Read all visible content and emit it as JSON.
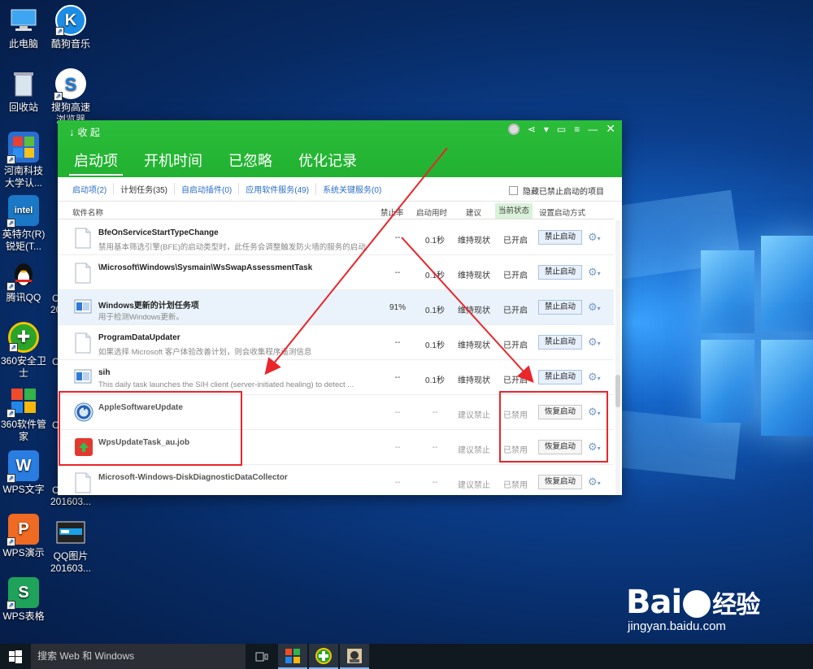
{
  "desktop": {
    "icons": [
      {
        "label": "此电脑",
        "glyph": "pc-icon"
      },
      {
        "label": "回收站",
        "glyph": "recycle-bin-icon"
      },
      {
        "label": "河南科技大学认...",
        "glyph": "shield-app-icon"
      },
      {
        "label": "英特尔(R) 锐矩(T...",
        "glyph": "intel-icon"
      },
      {
        "label": "腾讯QQ",
        "glyph": "qq-penguin-icon"
      },
      {
        "label": "360安全卫士",
        "glyph": "360-plus-icon"
      },
      {
        "label": "360软件管家",
        "glyph": "360-apps-icon"
      },
      {
        "label": "WPS文字",
        "glyph": "wps-writer-icon"
      },
      {
        "label": "WPS演示",
        "glyph": "wps-presentation-icon"
      },
      {
        "label": "WPS表格",
        "glyph": "wps-spreadsheet-icon"
      },
      {
        "label": "酷狗音乐",
        "glyph": "kugou-icon"
      },
      {
        "label": "搜狗高速浏览器",
        "glyph": "sogou-browser-icon"
      },
      {
        "label": "QQ图片 201603...",
        "glyph": "qq-image-icon"
      }
    ],
    "partial_labels": [
      "C",
      "201",
      "C",
      "C",
      "C",
      "C",
      "201603..."
    ]
  },
  "app": {
    "collapse_label": "收 起",
    "tabs": [
      "启动项",
      "开机时间",
      "已忽略",
      "优化记录"
    ],
    "active_tab": 0,
    "subtabs": [
      "启动项(2)",
      "计划任务(35)",
      "自启动插件(0)",
      "应用软件服务(49)",
      "系统关键服务(0)"
    ],
    "active_subtab": 1,
    "hide_disabled_label": "隐藏已禁止启动的项目",
    "columns": {
      "name": "软件名称",
      "disable_rate": "禁止率",
      "boot_time": "启动用时",
      "advice": "建议",
      "current_state": "当前状态",
      "set_mode": "设置启动方式"
    },
    "rows": [
      {
        "name": "BfeOnServiceStartTypeChange",
        "desc": "禁用基本筛选引擎(BFE)的启动类型时，此任务会调整触发防火墙的服务的启动类...",
        "rate": "--",
        "time": "0.1秒",
        "advice": "维持现状",
        "state": "已开启",
        "action": "禁止启动",
        "icon": "doc",
        "disabled": false,
        "selected": false
      },
      {
        "name": "\\Microsoft\\Windows\\Sysmain\\WsSwapAssessmentTask",
        "desc": "",
        "rate": "--",
        "time": "0.1秒",
        "advice": "维持现状",
        "state": "已开启",
        "action": "禁止启动",
        "icon": "doc",
        "disabled": false,
        "selected": false
      },
      {
        "name": "Windows更新的计划任务项",
        "desc": "用于检测Windows更新。",
        "rate": "91%",
        "time": "0.1秒",
        "advice": "维持现状",
        "state": "已开启",
        "action": "禁止启动",
        "icon": "win",
        "disabled": false,
        "selected": true
      },
      {
        "name": "ProgramDataUpdater",
        "desc": "如果选择 Microsoft 客户体验改善计划，则会收集程序遥测信息",
        "rate": "--",
        "time": "0.1秒",
        "advice": "维持现状",
        "state": "已开启",
        "action": "禁止启动",
        "icon": "doc",
        "disabled": false,
        "selected": false
      },
      {
        "name": "sih",
        "desc": "This daily task launches the SIH client (server-initiated healing) to detect ...",
        "rate": "--",
        "time": "0.1秒",
        "advice": "维持现状",
        "state": "已开启",
        "action": "禁止启动",
        "icon": "win",
        "disabled": false,
        "selected": false
      },
      {
        "name": "AppleSoftwareUpdate",
        "desc": "",
        "rate": "--",
        "time": "--",
        "advice": "建议禁止",
        "state": "已禁用",
        "action": "恢复启动",
        "icon": "apple",
        "disabled": true,
        "selected": false
      },
      {
        "name": "WpsUpdateTask_au.job",
        "desc": "",
        "rate": "--",
        "time": "--",
        "advice": "建议禁止",
        "state": "已禁用",
        "action": "恢复启动",
        "icon": "wps",
        "disabled": true,
        "selected": false
      },
      {
        "name": "Microsoft-Windows-DiskDiagnosticDataCollector",
        "desc": "",
        "rate": "--",
        "time": "--",
        "advice": "建议禁止",
        "state": "已禁用",
        "action": "恢复启动",
        "icon": "doc",
        "disabled": true,
        "selected": false
      }
    ]
  },
  "taskbar": {
    "search_placeholder": "搜索 Web 和 Windows"
  },
  "watermark": {
    "brand": "Bai",
    "brand_cn": "经验",
    "url": "jingyan.baidu.com"
  },
  "colors": {
    "header_green": "#22b131",
    "annotation_red": "#e8262b",
    "link_blue": "#2b6fc7"
  }
}
